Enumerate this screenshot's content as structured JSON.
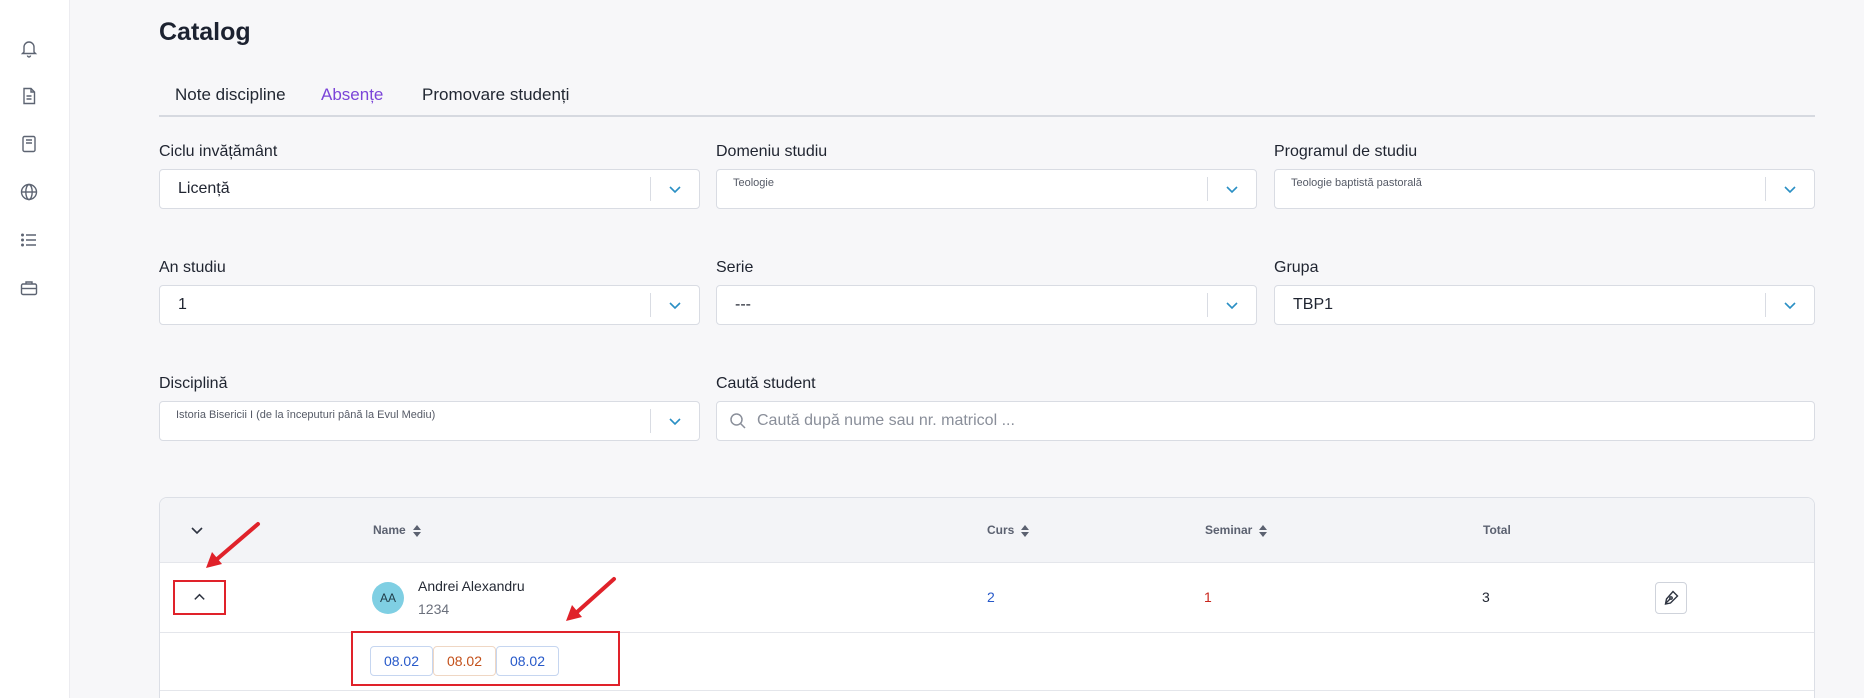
{
  "page": {
    "title": "Catalog"
  },
  "sidebar": {
    "icons": [
      "bell-icon",
      "document-icon",
      "book-icon",
      "globe-icon",
      "list-icon",
      "briefcase-icon"
    ]
  },
  "tabs": [
    {
      "label": "Note discipline",
      "active": false
    },
    {
      "label": "Absențe",
      "active": true
    },
    {
      "label": "Promovare studenți",
      "active": false
    }
  ],
  "filters": {
    "ciclu": {
      "label": "Ciclu invățământ",
      "value": "Licență"
    },
    "domeniu": {
      "label": "Domeniu studiu",
      "value": "Teologie"
    },
    "program": {
      "label": "Programul de studiu",
      "value": "Teologie baptistă pastorală"
    },
    "an": {
      "label": "An studiu",
      "value": "1"
    },
    "serie": {
      "label": "Serie",
      "value": "---"
    },
    "grupa": {
      "label": "Grupa",
      "value": "TBP1"
    },
    "disciplina": {
      "label": "Disciplină",
      "value": "Istoria Bisericii I (de la începuturi până la Evul Mediu)"
    },
    "cauta": {
      "label": "Caută student",
      "placeholder": "Caută după nume sau nr. matricol ..."
    }
  },
  "table": {
    "headers": {
      "name": "Name",
      "curs": "Curs",
      "seminar": "Seminar",
      "total": "Total"
    },
    "rows": [
      {
        "initials": "AA",
        "name": "Andrei Alexandru",
        "id": "1234",
        "curs": "2",
        "seminar": "1",
        "total": "3",
        "dates": [
          {
            "label": "08.02",
            "type": "curs"
          },
          {
            "label": "08.02",
            "type": "seminar"
          },
          {
            "label": "08.02",
            "type": "curs"
          }
        ]
      }
    ]
  },
  "colors": {
    "accent": "#7b44d8",
    "curs": "#2759c9",
    "seminar": "#c3501a",
    "annotation": "#e0222a",
    "chevron": "#2a8fc4"
  }
}
